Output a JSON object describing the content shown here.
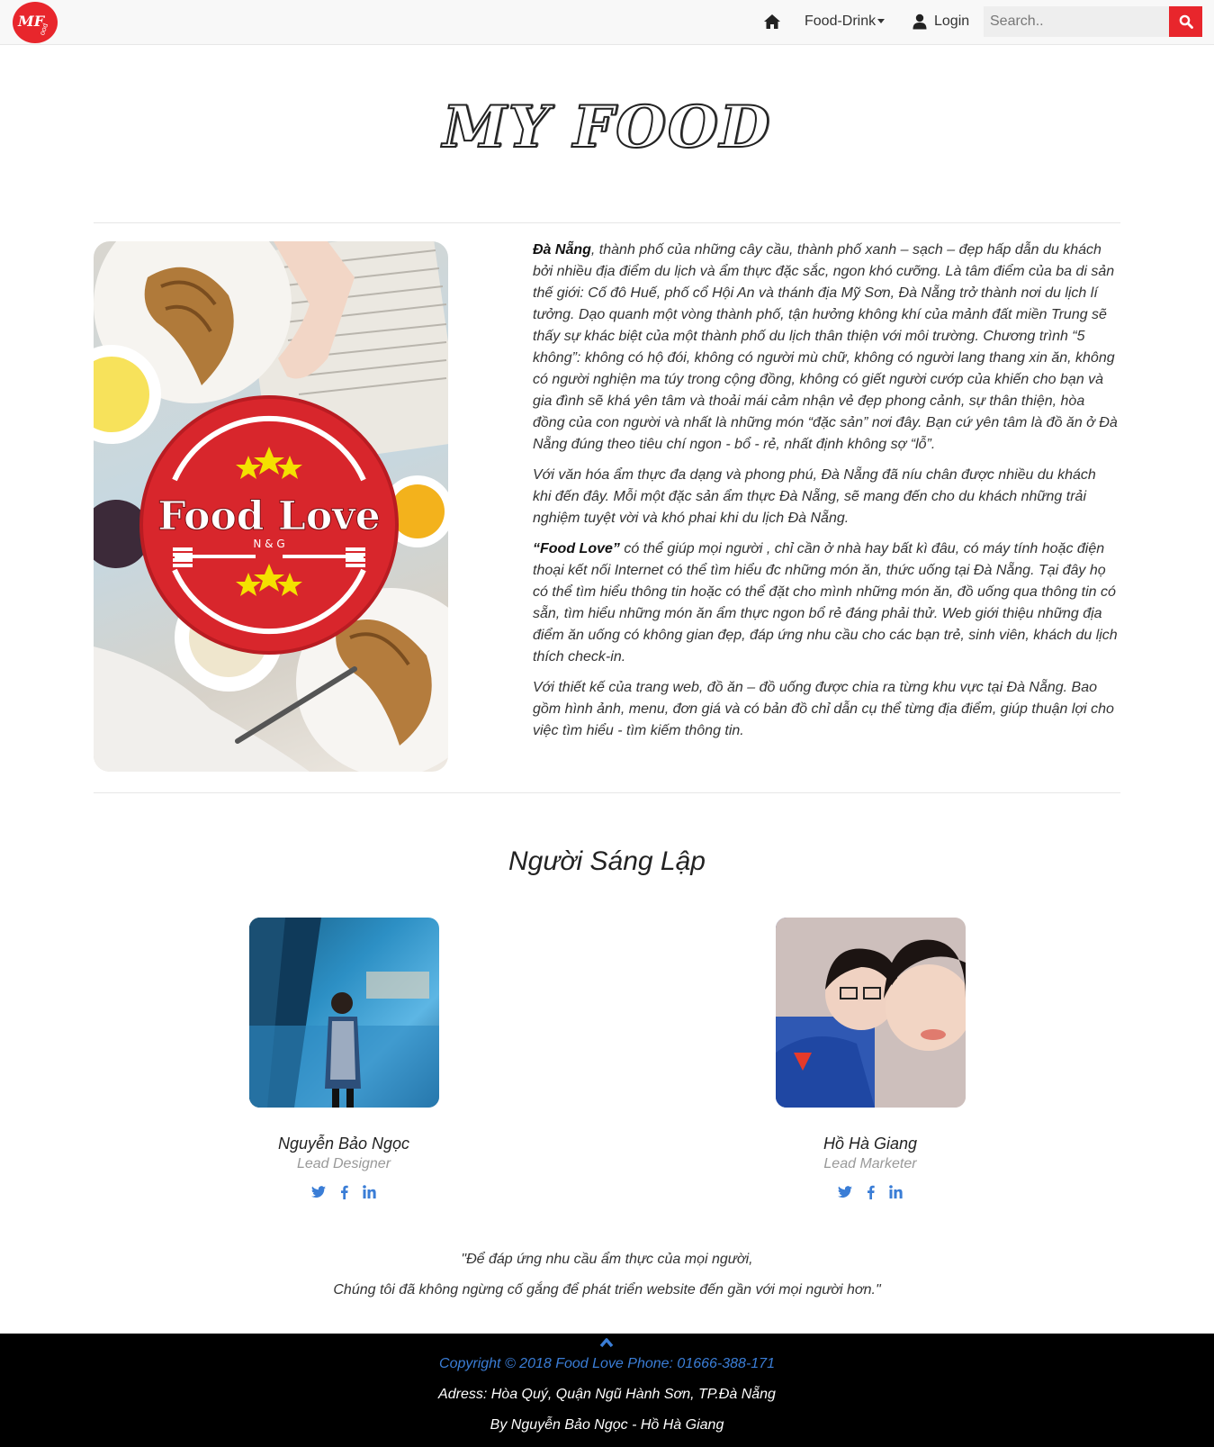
{
  "navbar": {
    "brand_text": "MF",
    "brand_sub": "ood",
    "home_icon": "home-icon",
    "food_drink_label": "Food-Drink",
    "login_label": "Login",
    "search_placeholder": "Search..",
    "search_icon": "search-icon",
    "accent_color": "#e8262c"
  },
  "hero": {
    "title": "MY FOOD",
    "image_alt": "Food Love",
    "paragraphs": [
      {
        "lead": "Đà Nẵng",
        "text": ", thành phố của những cây cầu, thành phố xanh – sạch – đẹp hấp dẫn du khách bởi nhiều địa điểm du lịch và ẩm thực đặc sắc, ngon khó cưỡng. Là tâm điểm của ba di sản thế giới: Cố đô Huế, phố cổ Hội An và thánh địa Mỹ Sơn, Đà Nẵng trở thành nơi du lịch lí tưởng. Dạo quanh một vòng thành phố, tận hưởng không khí của mảnh đất miền Trung sẽ thấy sự khác biệt của một thành phố du lịch thân thiện với môi trường. Chương trình “5 không”: không có hộ đói, không có người mù chữ, không có người lang thang xin ăn, không có người nghiện ma túy trong cộng đồng, không có giết người cướp của khiến cho bạn và gia đình sẽ khá yên tâm và thoải mái cảm nhận vẻ đẹp phong cảnh, sự thân thiện, hòa đồng của con người và nhất là những món “đặc sản” nơi đây. Bạn cứ yên tâm là đồ ăn ở Đà Nẵng đúng theo tiêu chí ngon - bổ - rẻ, nhất định không sợ “lỗ”."
      },
      {
        "lead": "",
        "text": "Với văn hóa ẩm thực đa dạng và phong phú, Đà Nẵng đã níu chân được nhiều du khách khi đến đây. Mỗi một đặc sản ẩm thực Đà Nẵng, sẽ mang đến cho du khách những trải nghiệm tuyệt vời và khó phai khi du lịch Đà Nẵng."
      },
      {
        "lead": "“Food Love”",
        "text": " có thể giúp mọi người , chỉ cần ở nhà hay bất kì đâu, có máy tính hoặc điện thoại kết nối Internet có thể tìm hiểu đc những món ăn, thức uống tại Đà Nẵng. Tại đây họ có thể tìm hiểu thông tin hoặc có thể đặt cho mình những món ăn, đồ uống qua thông tin có sẵn, tìm hiểu những món ăn ẩm thực ngon bổ rẻ đáng phải thử. Web giới thiệu những địa điểm ăn uống có không gian đẹp, đáp ứng nhu cầu cho các bạn trẻ, sinh viên, khách du lịch thích check-in."
      },
      {
        "lead": "",
        "text": "Với thiết kế của trang web, đồ ăn – đồ uống được chia ra từng khu vực tại Đà Nẵng. Bao gồm hình ảnh, menu, đơn giá và có bản đồ chỉ dẫn cụ thể từng địa điểm, giúp thuận lợi cho việc tìm hiểu - tìm kiếm thông tin."
      }
    ],
    "logo": {
      "title": "Food Love",
      "subtitle": "N & G"
    }
  },
  "founders": {
    "title": "Người Sáng Lập",
    "members": [
      {
        "name": "Nguyễn Bảo Ngọc",
        "role": "Lead Designer"
      },
      {
        "name": "Hồ Hà Giang",
        "role": "Lead Marketer"
      }
    ],
    "social_icons": [
      "twitter-icon",
      "facebook-icon",
      "linkedin-icon"
    ],
    "social_color": "#3a7dd6"
  },
  "quote": {
    "line1": "\"Để đáp ứng nhu cầu ẩm thực của mọi người,",
    "line2": "Chúng tôi đã không ngừng cố gắng để phát triển website đến gần với mọi người hơn.\""
  },
  "footer": {
    "up_icon": "chevron-up-icon",
    "copyright": "Copyright © 2018 Food Love Phone: 01666-388-171",
    "address": "Adress: Hòa Quý, Quận Ngũ Hành Sơn, TP.Đà Nẵng",
    "by": "By Nguyễn Bảo Ngọc - Hồ Hà Giang",
    "background": "#000000"
  }
}
